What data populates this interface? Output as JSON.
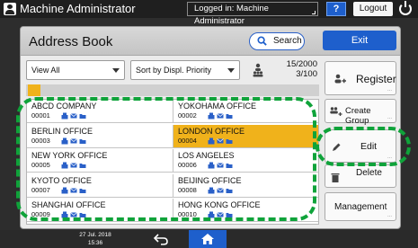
{
  "topbar": {
    "user": "Machine Administrator",
    "login_status": "Logged in: Machine Administrator",
    "help_label": "?",
    "logout_label": "Logout"
  },
  "header": {
    "title": "Address Book",
    "search_label": "Search",
    "exit_label": "Exit"
  },
  "filters": {
    "view": "View All",
    "sort": "Sort by Displ. Priority"
  },
  "counts": {
    "total": "15/2000",
    "selected": "3/100"
  },
  "entries": [
    {
      "name": "ABCD COMPANY",
      "number": "00001"
    },
    {
      "name": "YOKOHAMA OFFICE",
      "number": "00002"
    },
    {
      "name": "BERLIN OFFICE",
      "number": "00003"
    },
    {
      "name": "LONDON OFFICE",
      "number": "00004",
      "selected": true
    },
    {
      "name": "NEW YORK OFFICE",
      "number": "00005"
    },
    {
      "name": "LOS ANGELES",
      "number": "00006"
    },
    {
      "name": "KYOTO OFFICE",
      "number": "00007"
    },
    {
      "name": "BEIJING OFFICE",
      "number": "00008"
    },
    {
      "name": "SHANGHAI OFFICE",
      "number": "00009"
    },
    {
      "name": "HONG KONG OFFICE",
      "number": "00010"
    }
  ],
  "actions": {
    "register": "Register",
    "create_group": "Create Group",
    "edit": "Edit",
    "delete": "Delete",
    "management": "Management"
  },
  "statusbar": {
    "date": "27 Jul. 2018",
    "time": "15:36"
  },
  "colors": {
    "accent_blue": "#1e5fcc",
    "selected_row": "#f0b21b",
    "highlight_green": "#0fa33a"
  },
  "icons": [
    "user-icon",
    "power-icon",
    "search-icon",
    "users-count-icon",
    "register-user-icon",
    "create-group-icon",
    "edit-pencil-icon",
    "trash-icon",
    "back-arrow-icon",
    "home-icon",
    "fax-icon",
    "mail-icon",
    "folder-icon"
  ]
}
